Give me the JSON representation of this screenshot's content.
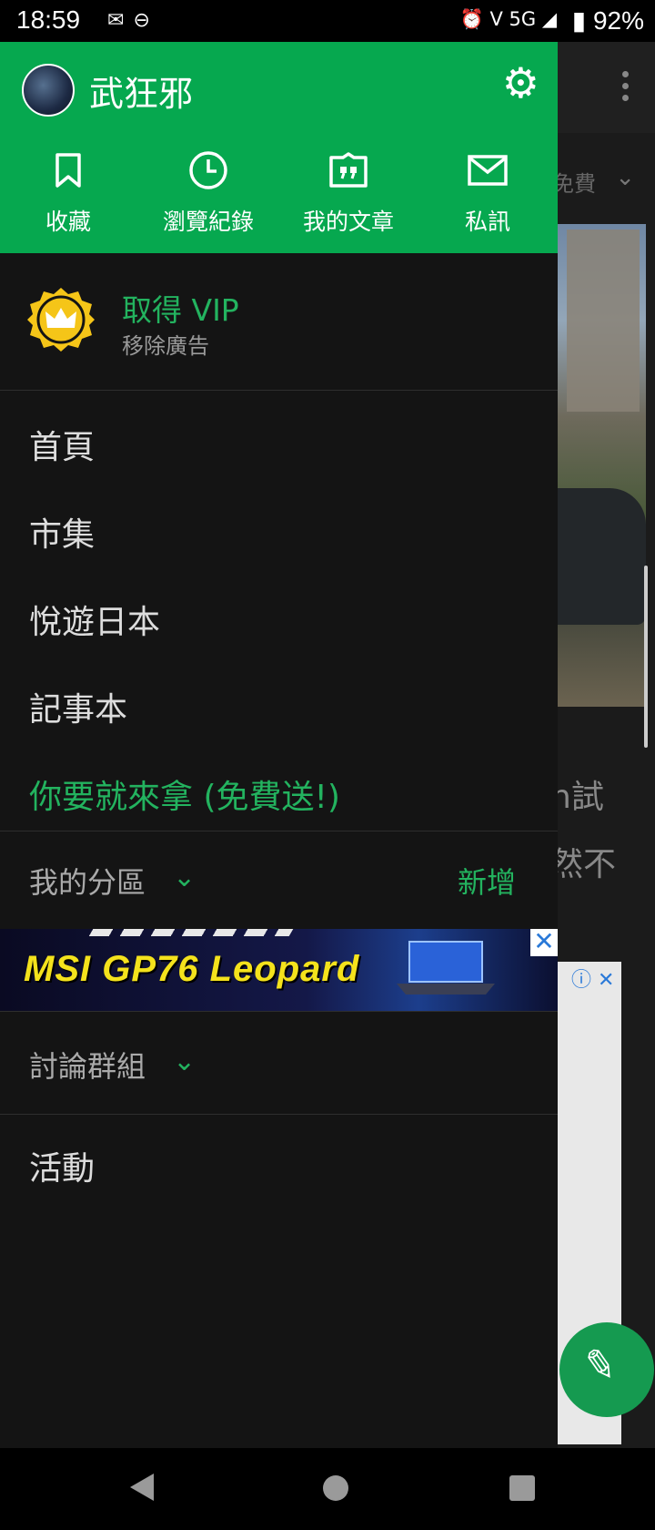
{
  "status_bar": {
    "time": "18:59",
    "battery": "92%",
    "network": "5G",
    "left_icons": [
      "mail-icon",
      "link-icon"
    ],
    "right_icons": [
      "alarm-icon",
      "volte-icon",
      "signal-icon",
      "battery-icon"
    ]
  },
  "drawer": {
    "header": {
      "username": "武狂邪",
      "settings_icon": "gear-icon",
      "quick_actions": [
        {
          "label": "收藏",
          "icon": "bookmark-icon"
        },
        {
          "label": "瀏覽紀錄",
          "icon": "clock-icon"
        },
        {
          "label": "我的文章",
          "icon": "article-icon"
        },
        {
          "label": "私訊",
          "icon": "mail-icon"
        }
      ]
    },
    "vip": {
      "title": "取得 VIP",
      "subtitle": "移除廣告",
      "icon": "crown-badge-icon"
    },
    "menu": [
      {
        "label": "首頁"
      },
      {
        "label": "市集"
      },
      {
        "label": "悅遊日本"
      },
      {
        "label": "記事本"
      },
      {
        "label": "你要就來拿 (免費送!)",
        "highlight": true
      }
    ],
    "my_sections": {
      "label": "我的分區",
      "add_label": "新增"
    },
    "ad": {
      "text": "MSI  GP76 Leopard",
      "close_icon": "close-icon"
    },
    "groups": {
      "label": "討論群組"
    },
    "events": {
      "label": "活動"
    }
  },
  "background_app": {
    "filter_text": "免費",
    "text_line_1": "n試",
    "text_line_2": "然不",
    "fab_icon": "pencil-icon"
  },
  "colors": {
    "header_green": "#06a84f",
    "accent_green": "#23b35f",
    "drawer_bg": "#141414",
    "vip_gold": "#f5c518"
  }
}
